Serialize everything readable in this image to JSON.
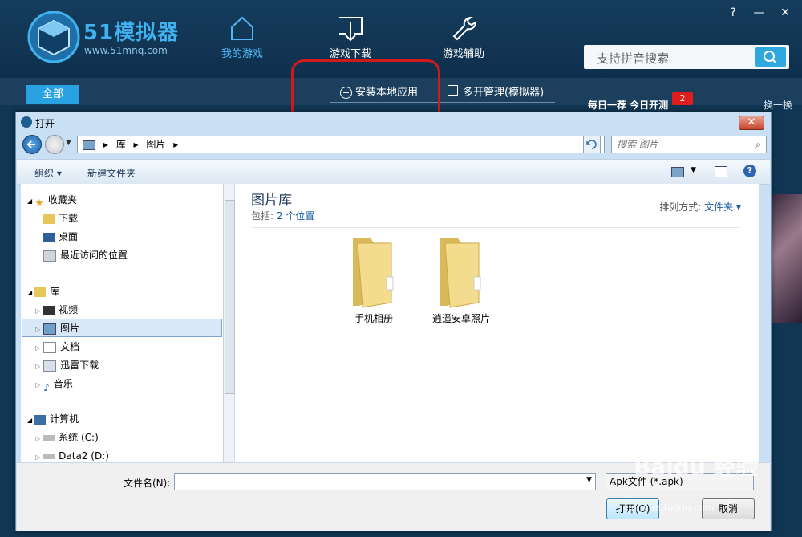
{
  "app": {
    "logo_title": "51模拟器",
    "logo_url": "www.51mnq.com",
    "nav": [
      {
        "label": "我的游戏",
        "icon": "home-icon",
        "active": true
      },
      {
        "label": "游戏下载",
        "icon": "download-icon",
        "active": false
      },
      {
        "label": "游戏辅助",
        "icon": "wrench-icon",
        "active": false
      }
    ],
    "help": "?",
    "minimize": "—",
    "close": "✕",
    "search_placeholder": "支持拼音搜索",
    "tabs": {
      "all": "全部",
      "install_local": "安装本地应用",
      "multi_open": "多开管理(模拟器)"
    },
    "daily_label": "每日一荐 今日开测",
    "badge_count": "2",
    "swap_label": "换一换",
    "accent_color": "#2aa2e2"
  },
  "dialog": {
    "title": "打开",
    "close": "✕",
    "breadcrumb": [
      "库",
      "图片"
    ],
    "search_placeholder": "搜索 图片",
    "toolbar": {
      "organize": "组织 ▾",
      "new_folder": "新建文件夹"
    },
    "tree": {
      "favorites": "收藏夹",
      "downloads": "下载",
      "desktop": "桌面",
      "recent": "最近访问的位置",
      "libraries": "库",
      "videos": "视频",
      "pictures": "图片",
      "documents": "文档",
      "xunlei": "迅雷下载",
      "music": "音乐",
      "computer": "计算机",
      "system_c": "系统 (C:)",
      "data2_d": "Data2 (D:)"
    },
    "library": {
      "title": "图片库",
      "includes_label": "包括:",
      "includes_link": "2 个位置",
      "sort_label": "排列方式:",
      "sort_value": "文件夹 ▾",
      "folders": [
        "手机相册",
        "逍遥安卓照片"
      ]
    },
    "filename_label": "文件名(N):",
    "filename_value": "",
    "filetype": "Apk文件 (*.apk)",
    "open_button": "打开(O)",
    "cancel_button": "取消"
  },
  "watermark": {
    "text": "Baidu 经验",
    "url": "jingyan.baidu.com"
  }
}
